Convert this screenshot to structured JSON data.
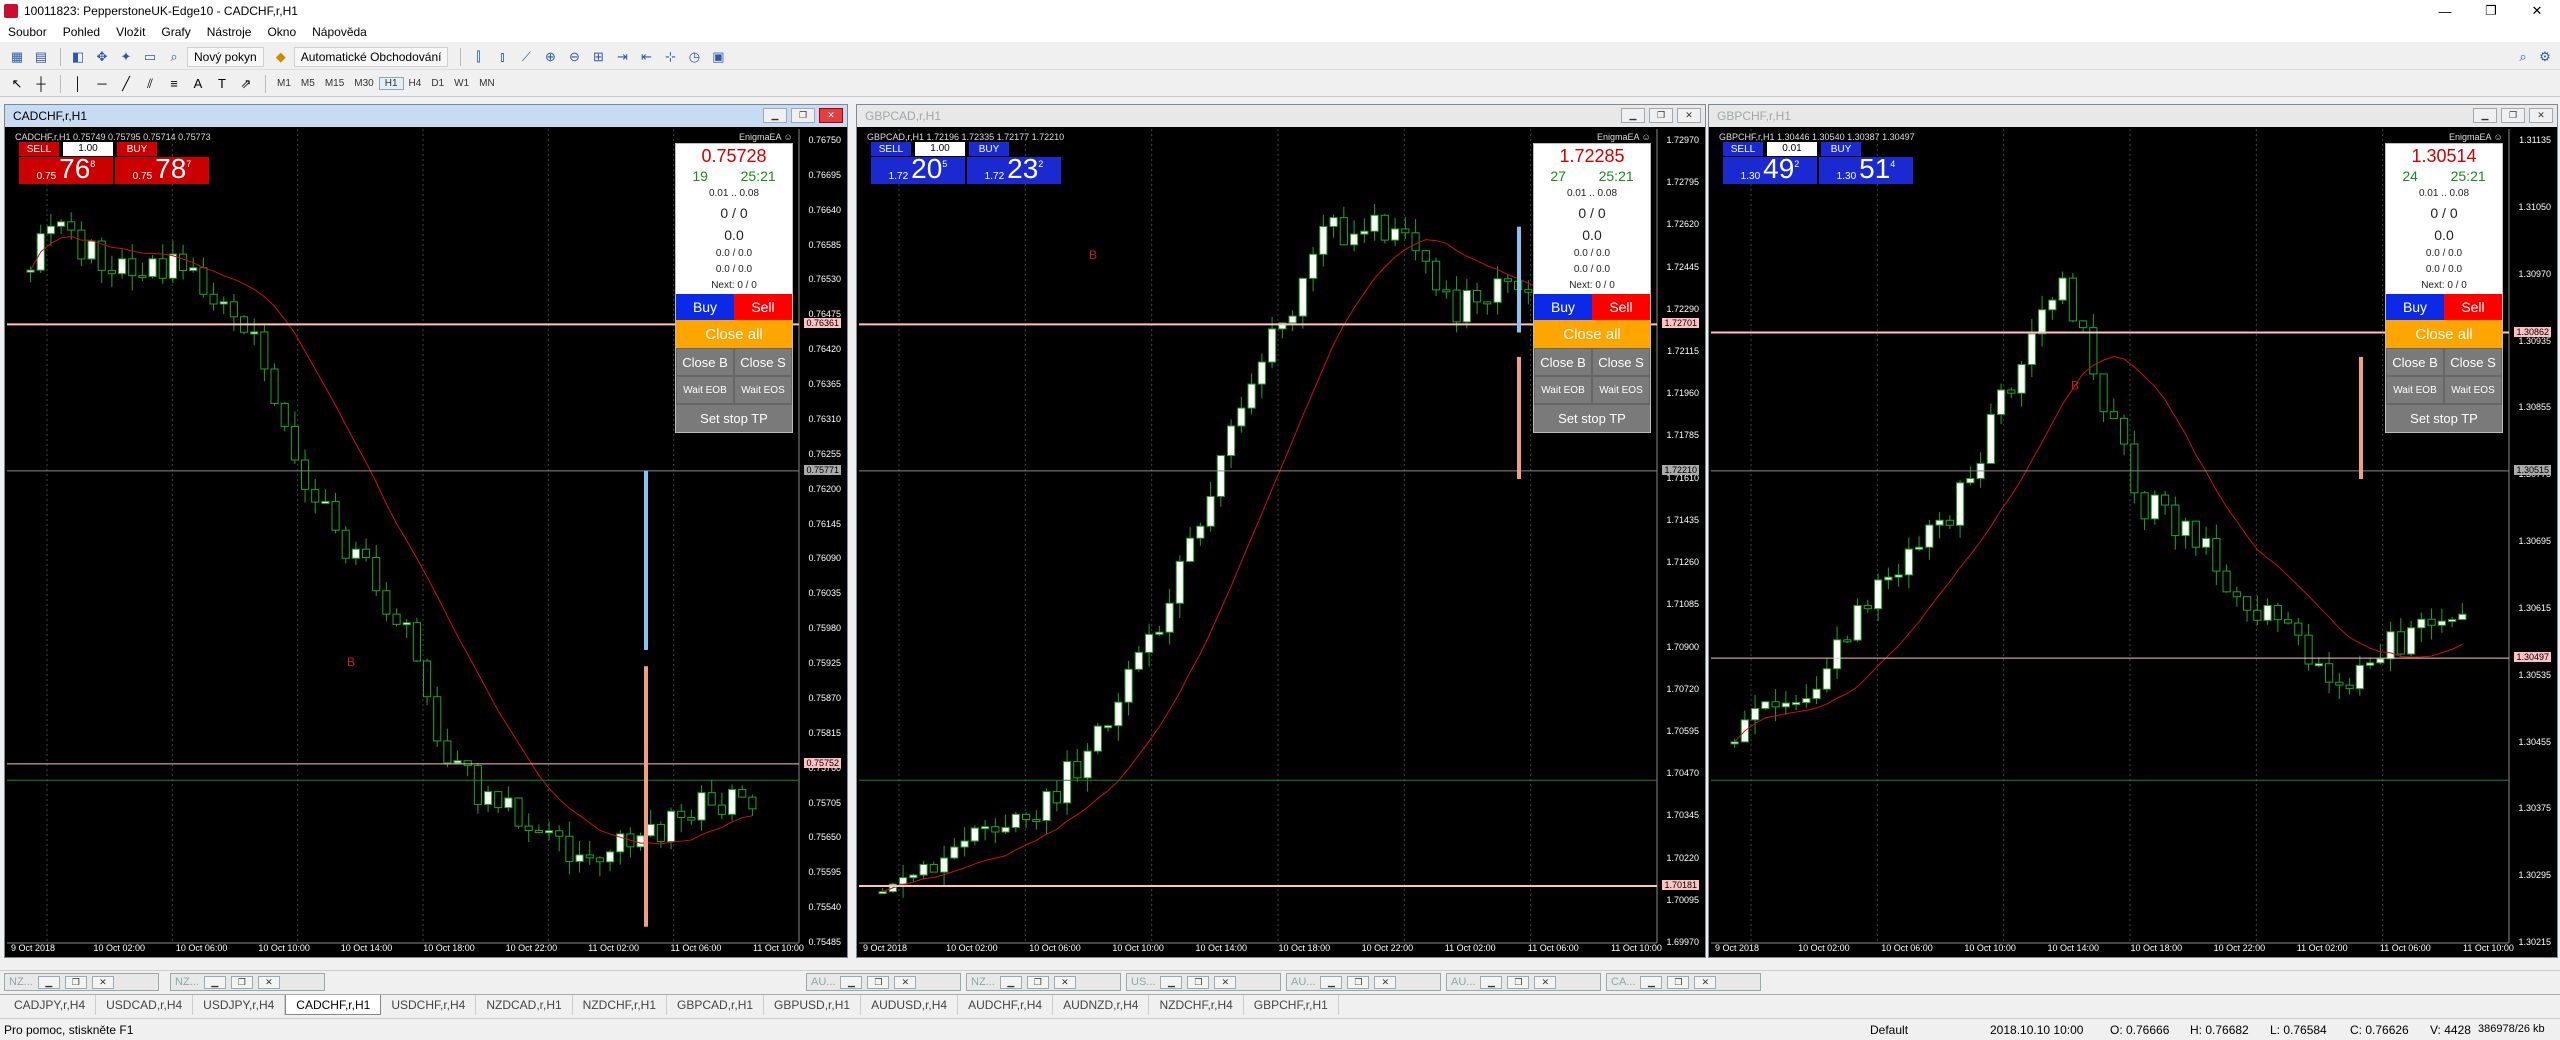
{
  "window": {
    "title": "10011823: PepperstoneUK-Edge10 - CADCHF,r,H1",
    "controls": [
      "—",
      "❐",
      "✕"
    ]
  },
  "menu": [
    "Soubor",
    "Pohled",
    "Vložit",
    "Grafy",
    "Nástroje",
    "Okno",
    "Nápověda"
  ],
  "toolbar": {
    "new_order": "Nový pokyn",
    "auto_trading": "Automatické Obchodování"
  },
  "timeframes": [
    "M1",
    "M5",
    "M15",
    "M30",
    "H1",
    "H4",
    "D1",
    "W1",
    "MN"
  ],
  "active_timeframe": "H1",
  "charts": [
    {
      "caption": "CADCHF,r,H1",
      "ohlc": "CADCHF,r,H1  0.75749 0.75795 0.75714 0.75773",
      "ea": "EnigmaEA ☺",
      "sell_label": "SELL",
      "buy_label": "BUY",
      "lot": "1.00",
      "bid_small": "0.75",
      "bid_big": "76",
      "bid_sup": "8",
      "ask_small": "0.75",
      "ask_big": "78",
      "ask_sup": "7",
      "trade_color": "#cc0000",
      "panel": {
        "price": "0.75728",
        "count": "19",
        "time": "25:21",
        "range": "0.01 .. 0.08",
        "l1": "0 / 0",
        "l2": "0.0",
        "l3": "0.0 / 0.0",
        "l4": "0.0 / 0.0",
        "next": "Next: 0 / 0",
        "buy": "Buy",
        "sell": "Sell",
        "close_all": "Close all",
        "close_b": "Close B",
        "close_s": "Close S",
        "wait_eob": "Wait EOB",
        "wait_eos": "Wait EOS",
        "set_stop": "Set stop TP"
      },
      "yticks": [
        "0.76750",
        "0.76695",
        "0.76640",
        "0.76585",
        "0.76530",
        "0.76475",
        "0.76420",
        "0.76365",
        "0.76310",
        "0.76255",
        "0.76200",
        "0.76145",
        "0.76090",
        "0.76035",
        "0.75980",
        "0.75925",
        "0.75870",
        "0.75815",
        "0.75760",
        "0.75705",
        "0.75650",
        "0.75595",
        "0.75540",
        "0.75485"
      ],
      "hl1": "0.76361",
      "hl2": "0.75752",
      "hl3": "0.75771",
      "xticks": [
        "9 Oct 2018",
        "10 Oct 02:00",
        "10 Oct 06:00",
        "10 Oct 10:00",
        "10 Oct 14:00",
        "10 Oct 18:00",
        "10 Oct 22:00",
        "11 Oct 02:00",
        "11 Oct 06:00",
        "11 Oct 10:00"
      ],
      "marker": "B"
    },
    {
      "caption": "GBPCAD,r,H1",
      "ohlc": "GBPCAD,r,H1  1.72196 1.72335 1.72177 1.72210",
      "ea": "EnigmaEA ☺",
      "sell_label": "SELL",
      "buy_label": "BUY",
      "lot": "1.00",
      "bid_small": "1.72",
      "bid_big": "20",
      "bid_sup": "5",
      "ask_small": "1.72",
      "ask_big": "23",
      "ask_sup": "2",
      "trade_color": "#1a2ad0",
      "panel": {
        "price": "1.72285",
        "count": "27",
        "time": "25:21",
        "range": "0.01 .. 0.08",
        "l1": "0 / 0",
        "l2": "0.0",
        "l3": "0.0 / 0.0",
        "l4": "0.0 / 0.0",
        "next": "Next: 0 / 0",
        "buy": "Buy",
        "sell": "Sell",
        "close_all": "Close all",
        "close_b": "Close B",
        "close_s": "Close S",
        "wait_eob": "Wait EOB",
        "wait_eos": "Wait EOS",
        "set_stop": "Set stop TP"
      },
      "yticks": [
        "1.72970",
        "1.72795",
        "1.72620",
        "1.72445",
        "1.72290",
        "1.72115",
        "1.71960",
        "1.71785",
        "1.71610",
        "1.71435",
        "1.71260",
        "1.71085",
        "1.70900",
        "1.70720",
        "1.70595",
        "1.70470",
        "1.70345",
        "1.70220",
        "1.70095",
        "1.69970"
      ],
      "hl1": "1.72701",
      "hl2": "1.70181",
      "hl3": "1.72210",
      "xticks": [
        "9 Oct 2018",
        "10 Oct 02:00",
        "10 Oct 06:00",
        "10 Oct 10:00",
        "10 Oct 14:00",
        "10 Oct 18:00",
        "10 Oct 22:00",
        "11 Oct 02:00",
        "11 Oct 06:00",
        "11 Oct 10:00"
      ],
      "marker": "B"
    },
    {
      "caption": "GBPCHF,r,H1",
      "ohlc": "GBPCHF,r,H1  1.30446 1.30540 1.30387 1.30497",
      "ea": "EnigmaEA ☺",
      "sell_label": "SELL",
      "buy_label": "BUY",
      "lot": "0.01",
      "bid_small": "1.30",
      "bid_big": "49",
      "bid_sup": "2",
      "ask_small": "1.30",
      "ask_big": "51",
      "ask_sup": "4",
      "trade_color": "#1a2ad0",
      "panel": {
        "price": "1.30514",
        "count": "24",
        "time": "25:21",
        "range": "0.01 .. 0.08",
        "l1": "0 / 0",
        "l2": "0.0",
        "l3": "0.0 / 0.0",
        "l4": "0.0 / 0.0",
        "next": "Next: 0 / 0",
        "buy": "Buy",
        "sell": "Sell",
        "close_all": "Close all",
        "close_b": "Close B",
        "close_s": "Close S",
        "wait_eob": "Wait EOB",
        "wait_eos": "Wait EOS",
        "set_stop": "Set stop TP"
      },
      "yticks": [
        "1.31135",
        "1.31050",
        "1.30970",
        "1.30935",
        "1.30855",
        "1.30775",
        "1.30695",
        "1.30615",
        "1.30535",
        "1.30455",
        "1.30375",
        "1.30295",
        "1.30215"
      ],
      "hl1": "1.30862",
      "hl2": "1.30497",
      "hl3": "1.30515",
      "xticks": [
        "9 Oct 2018",
        "10 Oct 02:00",
        "10 Oct 06:00",
        "10 Oct 10:00",
        "10 Oct 14:00",
        "10 Oct 18:00",
        "10 Oct 22:00",
        "11 Oct 02:00",
        "11 Oct 06:00",
        "11 Oct 10:00"
      ],
      "marker": "B"
    }
  ],
  "minimized": [
    "NZ...",
    "NZ...",
    "AU...",
    "NZ...",
    "US...",
    "AU...",
    "AU...",
    "CA..."
  ],
  "tabs": [
    "CADJPY,r,H4",
    "USDCAD,r,H4",
    "USDJPY,r,H4",
    "CADCHF,r,H1",
    "USDCHF,r,H4",
    "NZDCAD,r,H1",
    "NZDCHF,r,H1",
    "GBPCAD,r,H1",
    "GBPUSD,r,H1",
    "AUDUSD,r,H4",
    "AUDCHF,r,H4",
    "AUDNZD,r,H4",
    "NZDCHF,r,H4",
    "GBPCHF,r,H1"
  ],
  "active_tab": "CADCHF,r,H1",
  "status": {
    "help": "Pro pomoc, stiskněte F1",
    "profile": "Default",
    "time": "2018.10.10 10:00",
    "open": "O: 0.76666",
    "high": "H: 0.76682",
    "low": "L: 0.76584",
    "close": "C: 0.76626",
    "volume": "V: 4428",
    "traffic": "386978/26 kb"
  },
  "colors": {
    "bull": "#1ea51e",
    "ma": "#cc1010",
    "sell_red": "#ff0000",
    "buy_blue": "#0a2ae8",
    "orange": "#ffa500",
    "hline_pink": "#ffc0c0",
    "grid": "#555"
  }
}
